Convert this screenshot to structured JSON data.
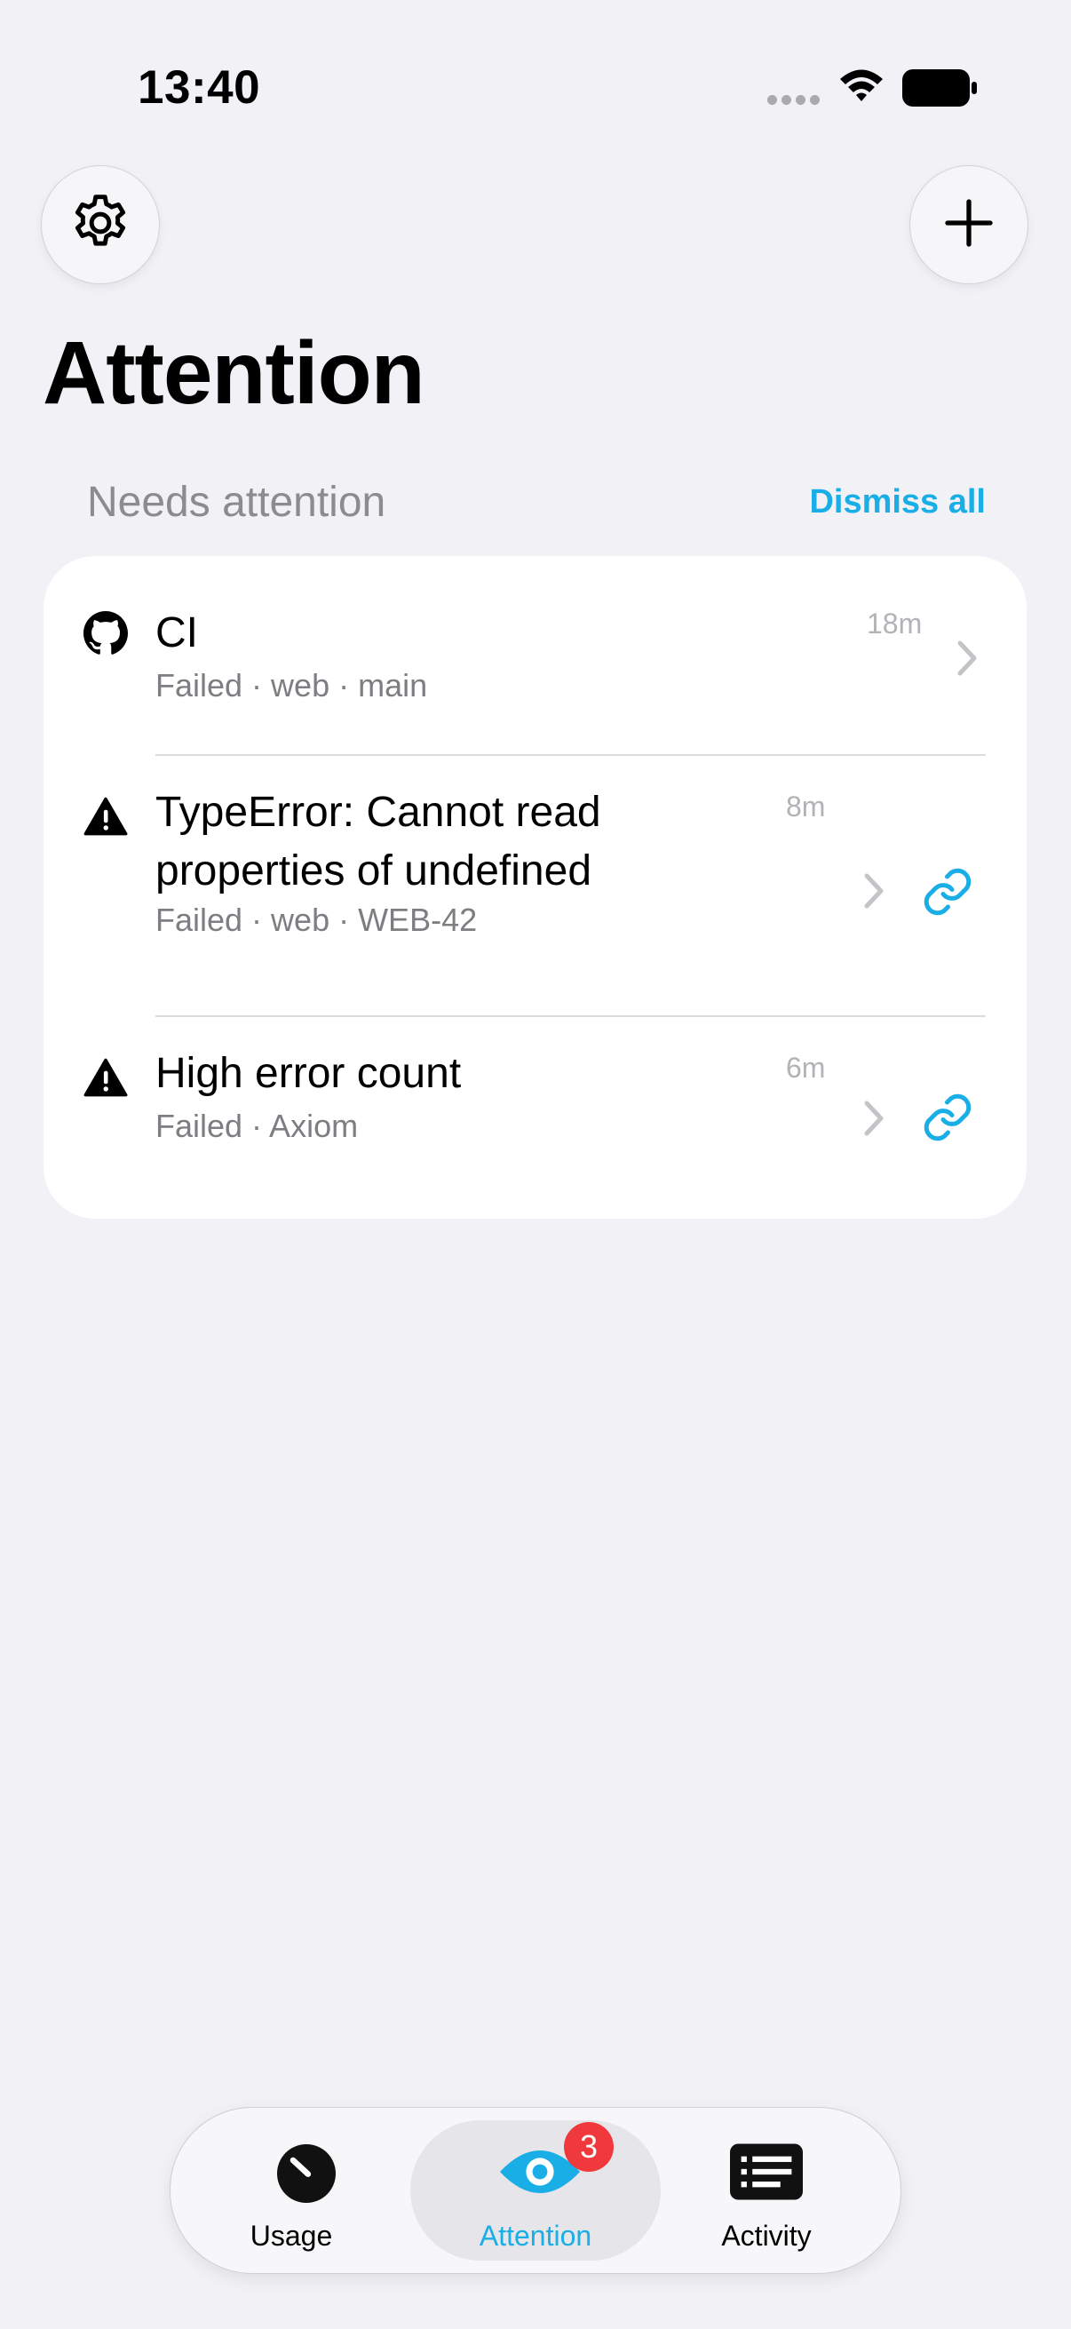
{
  "status_bar": {
    "time": "13:40"
  },
  "header": {
    "settings_icon": "gear-icon",
    "add_icon": "plus-icon",
    "title": "Attention"
  },
  "section": {
    "title": "Needs attention",
    "dismiss_label": "Dismiss all"
  },
  "items": [
    {
      "icon": "github-icon",
      "title_lines": [
        "CI"
      ],
      "subtitle": "Failed · web · main",
      "time": "18m",
      "has_link": false
    },
    {
      "icon": "warning-icon",
      "title_lines": [
        "TypeError: Cannot read",
        "properties of undefined"
      ],
      "subtitle": "Failed · web · WEB-42",
      "time": "8m",
      "has_link": true
    },
    {
      "icon": "warning-icon",
      "title_lines": [
        "High error count"
      ],
      "subtitle": "Failed · Axiom",
      "time": "6m",
      "has_link": true
    }
  ],
  "tabbar": {
    "tabs": [
      {
        "label": "Usage",
        "icon": "gauge-icon",
        "active": false
      },
      {
        "label": "Attention",
        "icon": "eye-icon",
        "active": true,
        "badge": "3"
      },
      {
        "label": "Activity",
        "icon": "list-icon",
        "active": false
      }
    ]
  },
  "colors": {
    "accent": "#1aaee6",
    "background": "#f2f1f6",
    "badge": "#f0393c",
    "secondary_text": "#7d7d82"
  }
}
